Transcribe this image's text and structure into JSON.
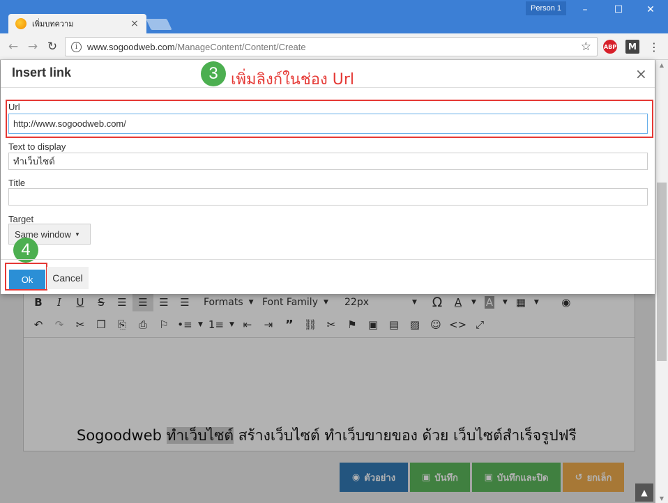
{
  "browser": {
    "tab_title": "เพิ่มบทความ",
    "person_label": "Person 1",
    "url_host": "www.sogoodweb.com",
    "url_path": "/ManageContent/Content/Create",
    "ext_abp": "ABP",
    "ext_m": "M"
  },
  "modal": {
    "title": "Insert link",
    "close": "×",
    "step3_number": "3",
    "step3_text": "เพิ่มลิงก์ในช่อง Url",
    "step4_number": "4",
    "url_label": "Url",
    "url_value": "http://www.sogoodweb.com/",
    "display_label": "Text to display",
    "display_value": "ทำเว็บไซต์",
    "title_label": "Title",
    "title_value": "",
    "target_label": "Target",
    "target_value": "Same window",
    "ok_label": "Ok",
    "cancel_label": "Cancel"
  },
  "editor": {
    "formats_label": "Formats",
    "font_family_label": "Font Family",
    "font_size_label": "22px",
    "text_before": "Sogoodweb ",
    "text_highlight": "ทำเว็บไซต์",
    "text_after": " สร้างเว็บไซต์ ทำเว็บขายของ ด้วย เว็บไซต์สำเร็จรูปฟรี"
  },
  "footer": {
    "preview_label": "ตัวอย่าง",
    "save_label": "บันทึก",
    "save_close_label": "บันทึกและปิด",
    "cancel_label": "ยกเล็ก"
  },
  "colors": {
    "chrome_blue": "#3c7fd5",
    "step_green": "#4caf50",
    "annotation_red": "#e53935",
    "ok_blue": "#2b8fd6",
    "preview_blue": "#337ab7",
    "save_green": "#5cb85c",
    "cancel_orange": "#f0ad4e"
  }
}
